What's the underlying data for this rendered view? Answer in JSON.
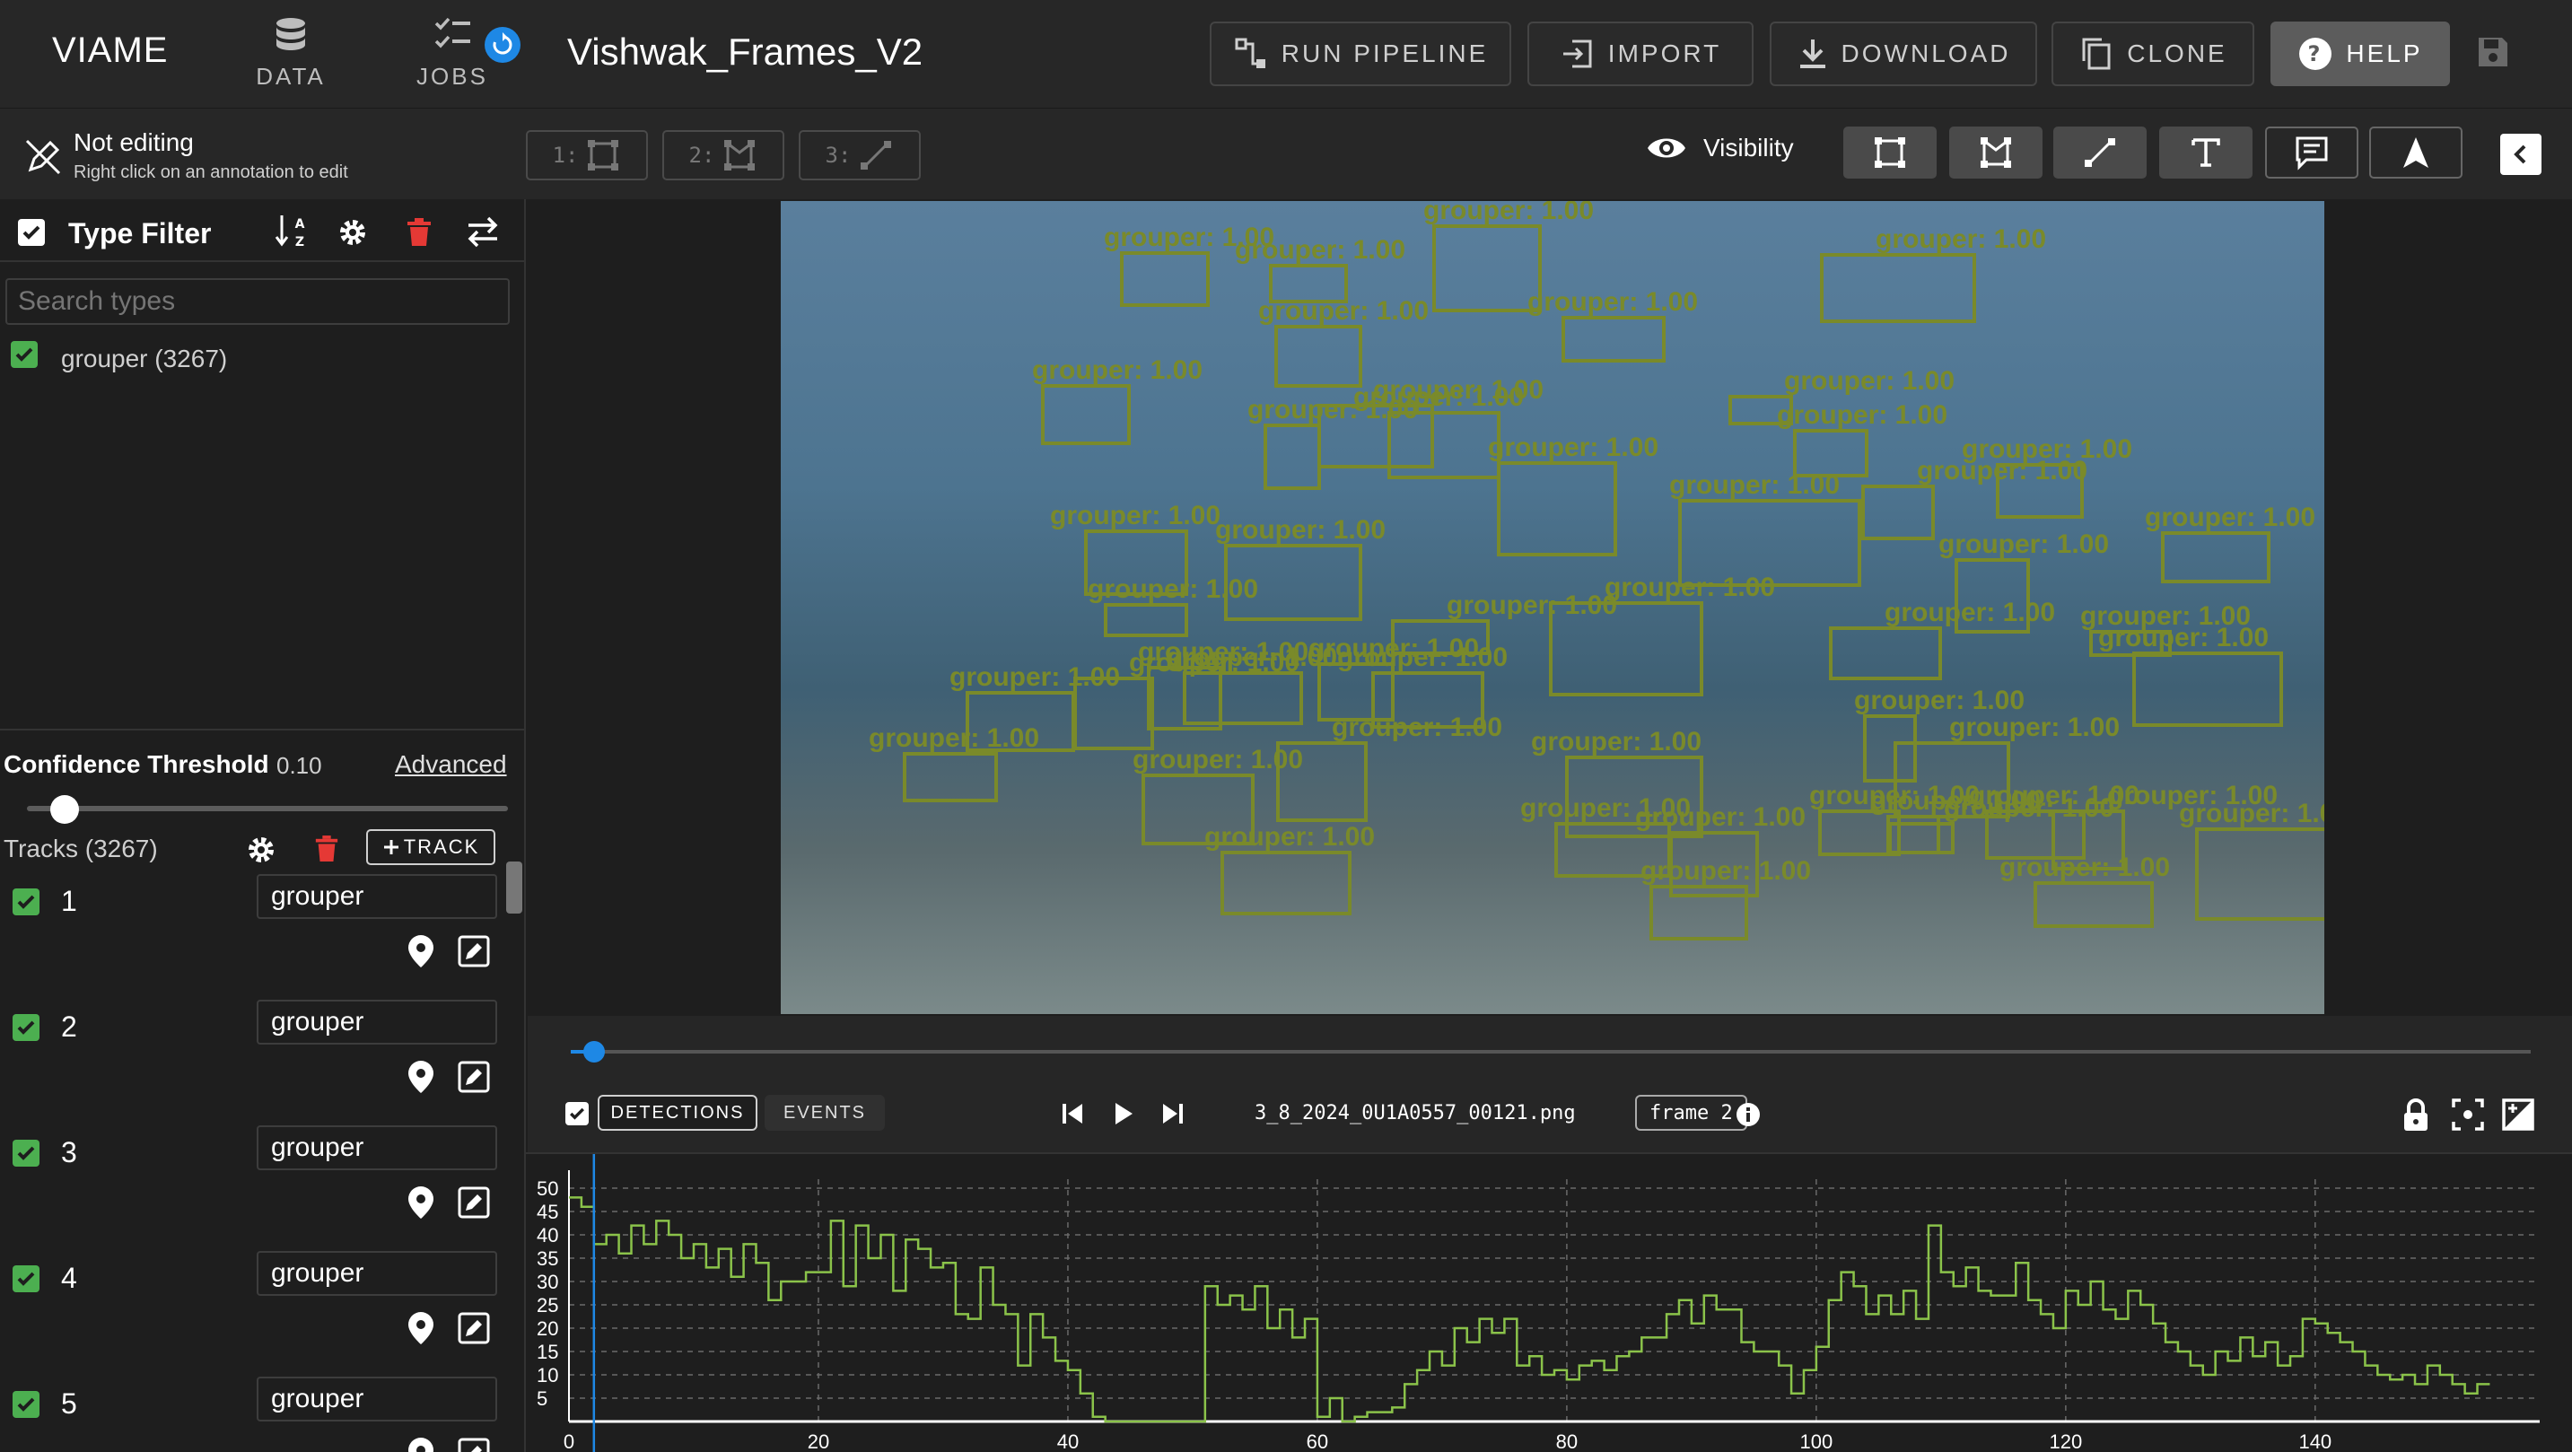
{
  "app": {
    "brand": "VIAME",
    "dataset_title": "Vishwak_Frames_V2"
  },
  "nav": {
    "data": "DATA",
    "jobs": "JOBS"
  },
  "toolbar": {
    "run_pipeline": "RUN PIPELINE",
    "import": "IMPORT",
    "download": "DOWNLOAD",
    "clone": "CLONE",
    "help": "HELP"
  },
  "edit_status": {
    "title": "Not editing",
    "subtitle": "Right click on an annotation to edit"
  },
  "edit_modes": [
    {
      "label": "1:"
    },
    {
      "label": "2:"
    },
    {
      "label": "3:"
    }
  ],
  "visibility": {
    "label": "Visibility"
  },
  "type_filter": {
    "title": "Type Filter",
    "search_placeholder": "Search types",
    "types": [
      {
        "label": "grouper (3267)"
      }
    ]
  },
  "confidence": {
    "label": "Confidence Threshold",
    "value": "0.10",
    "advanced": "Advanced",
    "level": 0.1
  },
  "tracks": {
    "label": "Tracks (3267)",
    "add_button": "TRACK",
    "rows": [
      {
        "id": "1",
        "type": "grouper"
      },
      {
        "id": "2",
        "type": "grouper"
      },
      {
        "id": "3",
        "type": "grouper"
      },
      {
        "id": "4",
        "type": "grouper"
      },
      {
        "id": "5",
        "type": "grouper"
      }
    ]
  },
  "detections": {
    "label": "grouper: 1.00"
  },
  "player": {
    "detections_tab": "DETECTIONS",
    "events_tab": "EVENTS",
    "filename": "3_8_2024_0U1A0557_00121.png",
    "frame": "frame 2"
  },
  "colors": {
    "accent": "#1e88e5",
    "detection": "#7a8a2a",
    "check": "#4caf50",
    "delete": "#e53935",
    "series": "#8bc34a"
  },
  "chart_data": {
    "type": "line",
    "title": "",
    "xlabel": "",
    "ylabel": "",
    "xlim": [
      0,
      158
    ],
    "ylim": [
      0,
      50
    ],
    "x_ticks": [
      0,
      20,
      40,
      60,
      80,
      100,
      120,
      140
    ],
    "y_ticks": [
      5,
      10,
      15,
      20,
      25,
      30,
      35,
      40,
      45,
      50
    ],
    "grid": true,
    "current_frame": 2,
    "series": [
      {
        "name": "",
        "values": [
          48,
          46,
          38,
          40,
          36,
          42,
          38,
          43,
          40,
          35,
          38,
          33,
          37,
          31,
          38,
          34,
          26,
          30,
          30,
          32,
          32,
          43,
          29,
          42,
          35,
          40,
          28,
          39,
          37,
          33,
          34,
          23,
          22,
          33,
          25,
          23,
          12,
          23,
          18,
          13,
          11,
          6,
          1,
          0,
          0,
          0,
          0,
          0,
          0,
          0,
          0,
          29,
          25,
          27,
          24,
          29,
          20,
          24,
          18,
          22,
          1,
          5,
          0,
          1,
          2,
          2,
          3,
          8,
          11,
          15,
          12,
          20,
          17,
          22,
          19,
          22,
          12,
          14,
          10,
          11,
          9,
          12,
          13,
          11,
          14,
          15,
          18,
          18,
          23,
          26,
          21,
          27,
          24,
          24,
          17,
          15,
          15,
          12,
          6,
          11,
          16,
          26,
          32,
          29,
          23,
          27,
          23,
          28,
          22,
          42,
          32,
          29,
          33,
          28,
          27,
          27,
          34,
          26,
          23,
          20,
          28,
          25,
          30,
          24,
          22,
          28,
          25,
          21,
          17,
          15,
          12,
          10,
          15,
          13,
          18,
          14,
          17,
          12,
          14,
          22,
          21,
          19,
          17,
          15,
          12,
          10,
          9,
          10,
          8,
          12,
          10,
          8,
          6,
          8
        ]
      }
    ]
  }
}
